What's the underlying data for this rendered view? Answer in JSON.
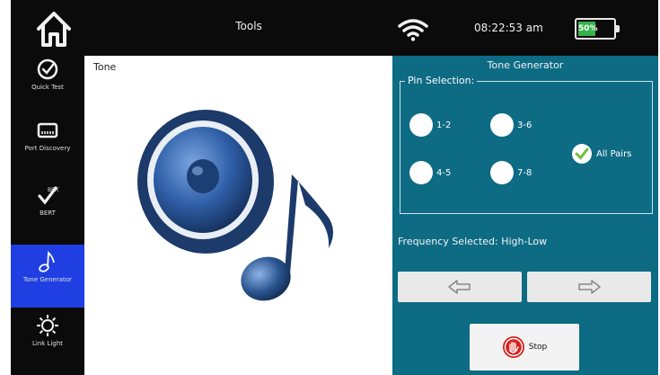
{
  "header": {
    "title": "Tools",
    "time": "08:22:53 am",
    "battery": "50%",
    "battery_level": 0.5,
    "icons": [
      "home-icon",
      "wifi-icon",
      "battery-icon"
    ]
  },
  "sidebar": {
    "items": [
      {
        "label": "Quick Test",
        "icon": "check-circle-icon",
        "active": false
      },
      {
        "label": "Port Discovery",
        "icon": "port-icon",
        "active": false
      },
      {
        "label": "BERT",
        "icon": "bert-icon",
        "active": false
      },
      {
        "label": "Tone Generator",
        "icon": "music-note-icon",
        "active": true
      },
      {
        "label": "Link Light",
        "icon": "link-light-icon",
        "active": false
      }
    ]
  },
  "content": {
    "title": "Tone",
    "illustration": "speaker-music-note-icon"
  },
  "panel": {
    "title": "Tone Generator",
    "pin_selection_label": "Pin Selection:",
    "pins": [
      {
        "label": "1-2"
      },
      {
        "label": "3-6"
      },
      {
        "label": "4-5"
      },
      {
        "label": "7-8"
      }
    ],
    "all_pairs_label": "All Pairs",
    "all_pairs_checked": true,
    "frequency_text": "Frequency Selected: High-Low",
    "stop_label": "Stop"
  },
  "colors": {
    "panel_bg": "#0d6b84",
    "active_nav": "#1f3fe3",
    "battery": "#35b24a",
    "check": "#6fbf3f",
    "stop_red": "#d8211d",
    "speaker_blue": "#1c3a6a"
  }
}
